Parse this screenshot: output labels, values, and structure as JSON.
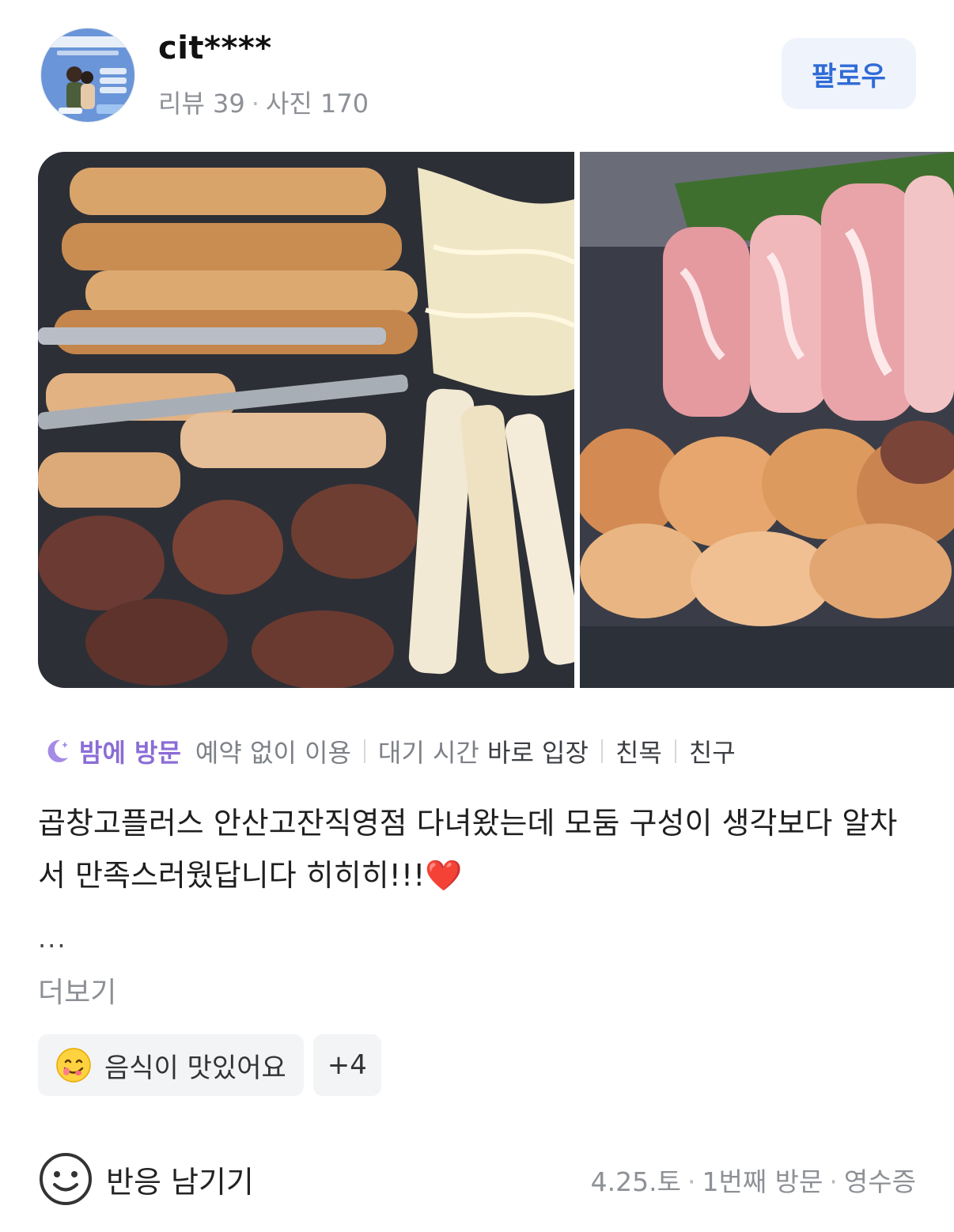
{
  "profile": {
    "username": "cit****",
    "reviews_label": "리뷰 39",
    "photos_label": "사진 170",
    "follow_label": "팔로우"
  },
  "photos": [
    {
      "icon": "grilled-gopchang-photo"
    },
    {
      "icon": "raw-pork-and-gopchang-photo"
    }
  ],
  "visit_info": {
    "time_icon": "moon-icon",
    "time": "밤에 방문",
    "items": [
      {
        "key": "예약 없이 이용",
        "value": ""
      },
      {
        "key": "대기 시간",
        "value": "바로 입장"
      },
      {
        "key": "",
        "value": "친목"
      },
      {
        "key": "",
        "value": "친구"
      }
    ]
  },
  "review": {
    "text": "곱창고플러스 안산고잔직영점 다녀왔는데 모둠 구성이 생각보다 알차서 만족스러웠답니다 히히히!!!❤️",
    "ellipsis": "...",
    "more_label": "더보기"
  },
  "keywords": {
    "first": {
      "emoji": "yum-face-icon",
      "label": "음식이 맛있어요"
    },
    "more_label": "+4"
  },
  "footer": {
    "react_icon": "smile-icon",
    "react_label": "반응 남기기",
    "date": "4.25.토",
    "visit_count": "1번째 방문",
    "receipt": "영수증"
  },
  "colors": {
    "accent_blue": "#2f6bd6",
    "follow_bg": "#eff3fb",
    "night_purple": "#8b6dd6",
    "muted_text": "#8d9196"
  }
}
